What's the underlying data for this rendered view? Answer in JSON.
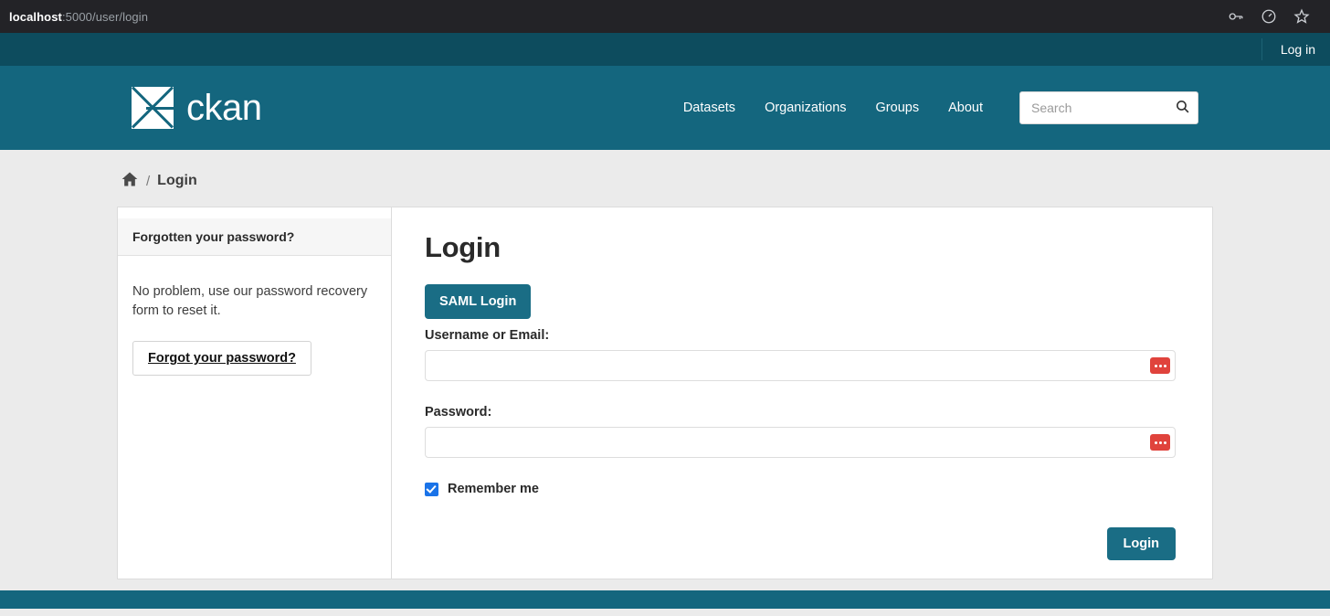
{
  "browser": {
    "url_host": "localhost",
    "url_path": ":5000/user/login",
    "icons": [
      "key-icon",
      "speedometer-icon",
      "star-icon"
    ]
  },
  "account_bar": {
    "login_label": "Log in"
  },
  "masthead": {
    "logo_text": "ckan",
    "nav": [
      {
        "label": "Datasets",
        "name": "nav-datasets"
      },
      {
        "label": "Organizations",
        "name": "nav-organizations"
      },
      {
        "label": "Groups",
        "name": "nav-groups"
      },
      {
        "label": "About",
        "name": "nav-about"
      }
    ],
    "search": {
      "placeholder": "Search",
      "value": ""
    }
  },
  "breadcrumb": {
    "home_icon": "home-icon",
    "separator": "/",
    "current": "Login"
  },
  "sidebar": {
    "module_heading": "Forgotten your password?",
    "body_text": "No problem, use our password recovery form to reset it.",
    "forgot_button_label": "Forgot your password?"
  },
  "main": {
    "page_title": "Login",
    "saml_button_label": "SAML Login",
    "username_label": "Username or Email:",
    "username_value": "",
    "password_label": "Password:",
    "password_value": "",
    "remember_me_label": "Remember me",
    "remember_me_checked": true,
    "submit_label": "Login"
  },
  "colors": {
    "brand_teal": "#14667e",
    "account_bar": "#0d4c5e",
    "button_teal": "#1a6d85",
    "page_background": "#ebebeb",
    "checkbox_blue": "#1a73e8",
    "pwmgr_red": "#e0433c"
  }
}
